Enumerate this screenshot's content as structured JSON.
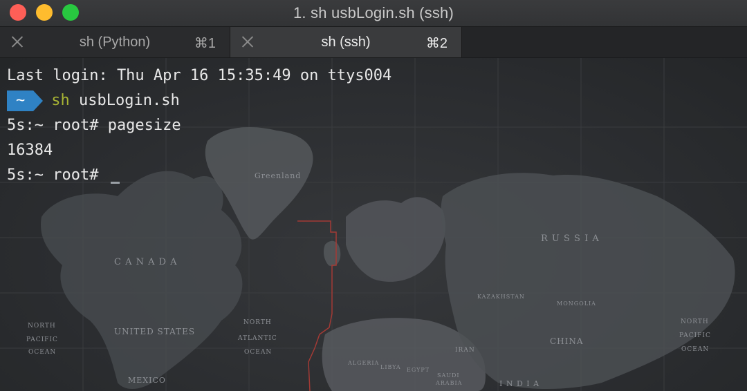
{
  "window": {
    "title": "1. sh usbLogin.sh (ssh)"
  },
  "tabs": [
    {
      "label": "sh (Python)",
      "shortcut": "⌘1",
      "active": false
    },
    {
      "label": "sh (ssh)",
      "shortcut": "⌘2",
      "active": true
    }
  ],
  "terminal": {
    "last_login": "Last login: Thu Apr 16 15:35:49 on ttys004",
    "prompt_segment": "~",
    "cmd_sh": "sh",
    "cmd_rest": " usbLogin.sh",
    "line3": "5s:~ root# pagesize",
    "line4": "16384",
    "line5": "5s:~ root# "
  },
  "map_labels": {
    "greenland": "Greenland",
    "canada": "C A N A D A",
    "united_states": "UNITED STATES",
    "mexico": "MEXICO",
    "north_atlantic": [
      "NORTH",
      "ATLANTIC",
      "OCEAN"
    ],
    "north_pacific_left": [
      "NORTH",
      "PACIFIC",
      "OCEAN"
    ],
    "north_pacific_right": [
      "NORTH",
      "PACIFIC",
      "OCEAN"
    ],
    "russia": "R U S S I A",
    "kazakhstan": "KAZAKHSTAN",
    "mongolia": "MONGOLIA",
    "china": "CHINA",
    "iran": "IRAN",
    "india": "I N D I A",
    "algeria": "ALGERIA",
    "libya": "LIBYA",
    "egypt": "EGYPT",
    "saudi_arabia": [
      "SAUDI",
      "ARABIA"
    ]
  },
  "colors": {
    "accent_prompt": "#2f82c4",
    "command_highlight": "#a8b434",
    "close_button": "#fe5f57",
    "minimize_button": "#febc2e",
    "zoom_button": "#28c840"
  }
}
